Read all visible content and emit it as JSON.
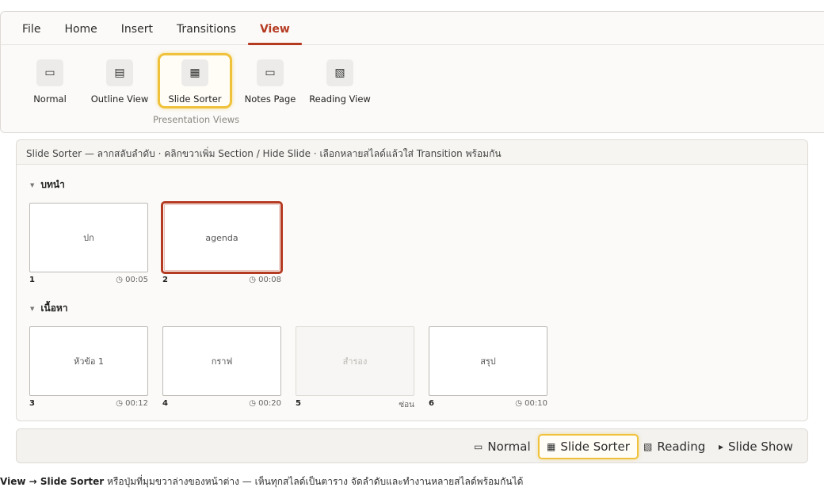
{
  "ribbon": {
    "tabs": [
      {
        "label": "File"
      },
      {
        "label": "Home"
      },
      {
        "label": "Insert"
      },
      {
        "label": "Transitions"
      },
      {
        "label": "View"
      }
    ],
    "active_tab": "View",
    "buttons": [
      {
        "label": "Normal",
        "icon": "normal-view-icon"
      },
      {
        "label": "Outline View",
        "icon": "outline-view-icon"
      },
      {
        "label": "Slide Sorter",
        "icon": "slide-sorter-icon"
      },
      {
        "label": "Notes Page",
        "icon": "notes-page-icon"
      },
      {
        "label": "Reading View",
        "icon": "reading-view-icon"
      }
    ],
    "group_label": "Presentation Views"
  },
  "sorter": {
    "hint": "Slide Sorter — ลากสลับลำดับ · คลิกขวาเพิ่ม Section / Hide Slide · เลือกหลายสไลด์แล้วใส่ Transition พร้อมกัน",
    "sections": [
      {
        "name": "บทนำ",
        "slides": [
          {
            "number": "1",
            "title": "ปก",
            "duration": "◷ 00:05"
          },
          {
            "number": "2",
            "title": "agenda",
            "duration": "◷ 00:08",
            "selected": true
          }
        ]
      },
      {
        "name": "เนื้อหา",
        "slides": [
          {
            "number": "3",
            "title": "หัวข้อ 1",
            "duration": "◷ 00:12"
          },
          {
            "number": "4",
            "title": "กราฟ",
            "duration": "◷ 00:20"
          },
          {
            "number": "5",
            "title": "สำรอง",
            "duration": "ซ่อน",
            "hidden": true
          },
          {
            "number": "6",
            "title": "สรุป",
            "duration": "◷ 00:10"
          }
        ]
      }
    ]
  },
  "statusbar": {
    "normal": "Normal",
    "slide_sorter": "Slide Sorter",
    "reading": "Reading",
    "slide_show": "Slide Show",
    "icons": {
      "normal": "▭",
      "slide_sorter": "▦",
      "reading": "▧",
      "slide_show": "▸"
    }
  },
  "caption": {
    "bold": "View → Slide Sorter",
    "text": " หรือปุ่มที่มุมขวาล่างของหน้าต่าง — เห็นทุกสไลด์เป็นตาราง จัดลำดับและทำงานหลายสไลด์พร้อมกันได้"
  },
  "colors": {
    "accent": "#b53a22",
    "highlight": "#f0c23c"
  }
}
